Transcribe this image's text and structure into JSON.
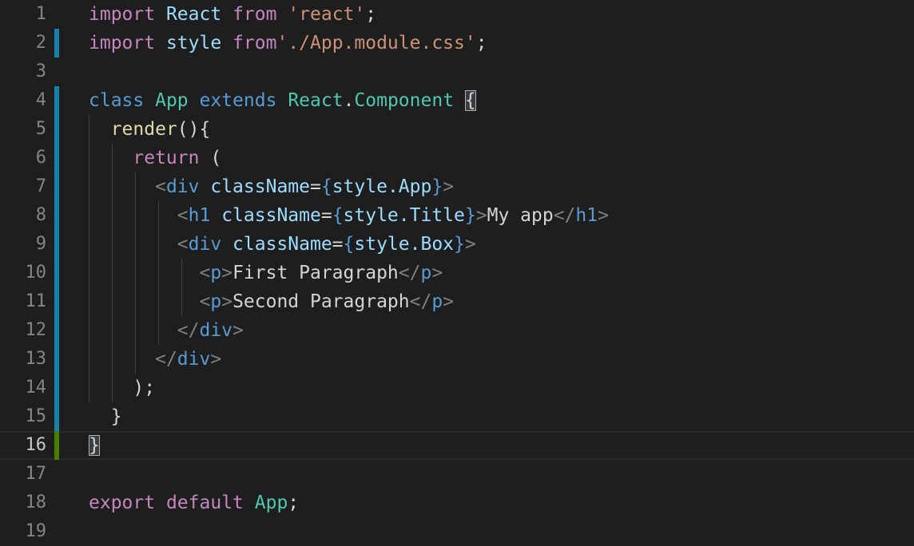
{
  "editor": {
    "line_numbers": [
      "1",
      "2",
      "3",
      "4",
      "5",
      "6",
      "7",
      "8",
      "9",
      "10",
      "11",
      "12",
      "13",
      "14",
      "15",
      "16",
      "17",
      "18",
      "19"
    ],
    "tokens": {
      "import": "import",
      "from": "from",
      "react_ident": "React",
      "react_str": "'react'",
      "style_ident": "style",
      "app_css_str": "'./App.module.css'",
      "semicolon": ";",
      "class": "class",
      "app": "App",
      "extends": "extends",
      "react_ns": "React",
      "dot": ".",
      "component": "Component",
      "open_brace": "{",
      "close_brace": "}",
      "render": "render",
      "parens_brace": "(){",
      "return": "return",
      "open_paren": "(",
      "lt": "<",
      "gt": ">",
      "lt_slash": "</",
      "div": "div",
      "h1": "h1",
      "p": "p",
      "classname": "className",
      "equals": "=",
      "style_app": "style.App",
      "style_title": "style.Title",
      "style_box": "style.Box",
      "my_app": "My app",
      "first_paragraph": "First Paragraph",
      "second_paragraph": "Second Paragraph",
      "close_paren_semi": ");",
      "export": "export",
      "default": "default",
      "app_semi": ";"
    }
  }
}
